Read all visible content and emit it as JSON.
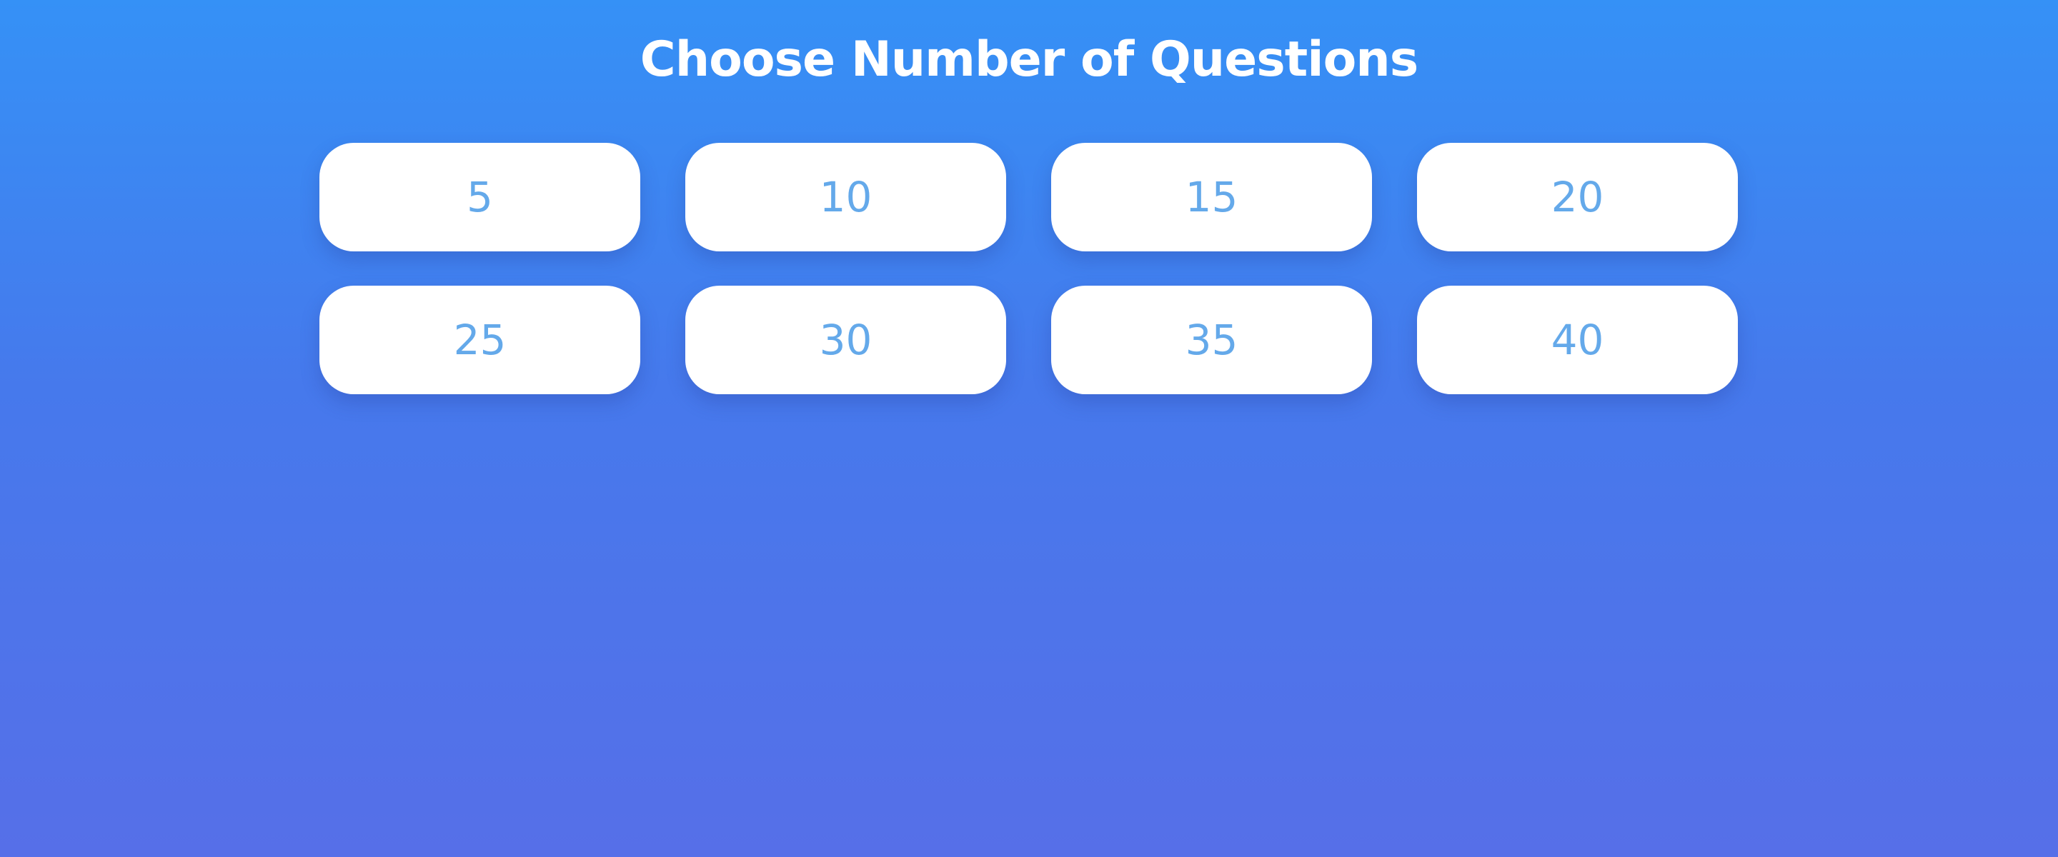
{
  "header": {
    "title": "Choose Number of Questions"
  },
  "options": [
    {
      "label": "5"
    },
    {
      "label": "10"
    },
    {
      "label": "15"
    },
    {
      "label": "20"
    },
    {
      "label": "25"
    },
    {
      "label": "30"
    },
    {
      "label": "35"
    },
    {
      "label": "40"
    }
  ],
  "colors": {
    "background_top": "#3591f6",
    "background_bottom": "#566fe8",
    "button_background": "#ffffff",
    "button_text": "#64a9ea",
    "title_text": "#ffffff"
  }
}
